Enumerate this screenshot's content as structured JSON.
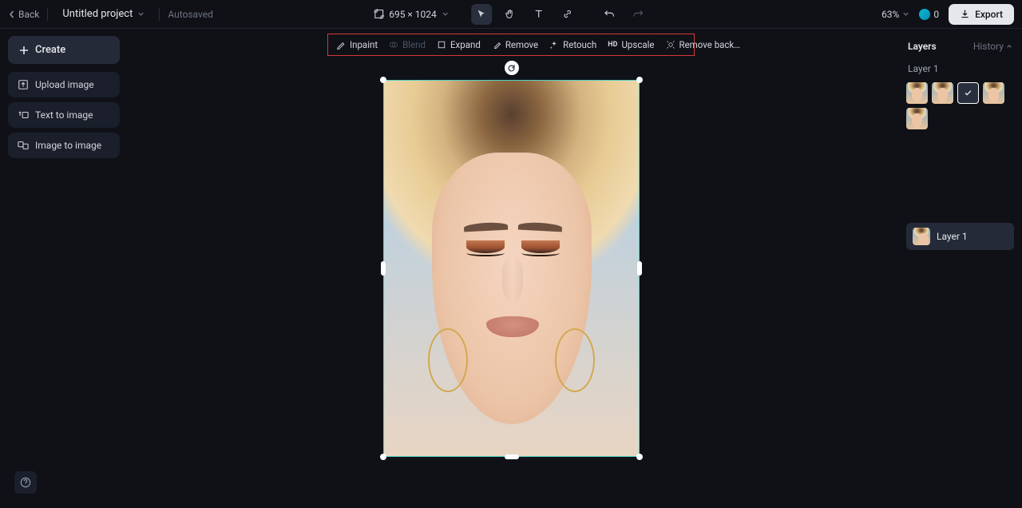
{
  "topbar": {
    "back": "Back",
    "project": "Untitled project",
    "autosaved": "Autosaved",
    "dimensions": "695 × 1024",
    "zoom": "63%",
    "credits": "0",
    "export": "Export"
  },
  "sidebar": {
    "create": "Create",
    "items": [
      {
        "label": "Upload image"
      },
      {
        "label": "Text to image"
      },
      {
        "label": "Image to image"
      }
    ]
  },
  "toolbar": {
    "inpaint": "Inpaint",
    "blend": "Blend",
    "expand": "Expand",
    "remove": "Remove",
    "retouch": "Retouch",
    "upscale": "Upscale",
    "removeBg": "Remove back…"
  },
  "panel": {
    "layers": "Layers",
    "history": "History",
    "layerName": "Layer 1",
    "rowLayer": "Layer 1"
  }
}
